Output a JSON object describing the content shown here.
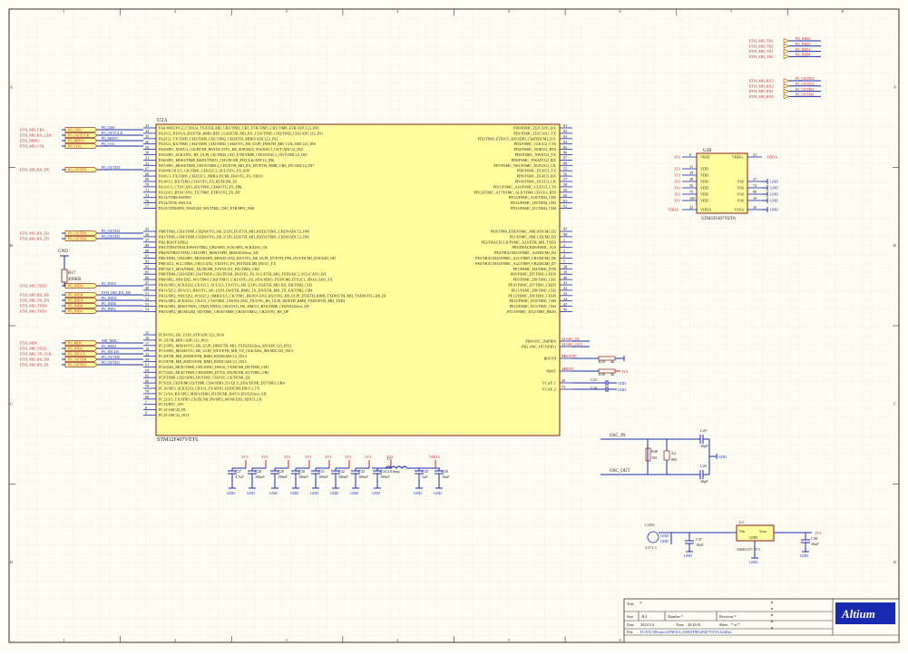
{
  "ruler": {
    "cols": [
      "1",
      "2",
      "3",
      "4",
      "5",
      "6",
      "7",
      "8"
    ],
    "rows": [
      "A",
      "B",
      "C",
      "D"
    ]
  },
  "mcu": {
    "designator": "U2A",
    "part": "STM32F407VET6",
    "left_pins": [
      {
        "num": "23",
        "label": "PA0-WKUP/U2_CTS/U4_TX/ETH_MII_CRS/TIM2_CH1_ETR/TIM5_CH1/TIM8_ETR/ADC123_IN0"
      },
      {
        "num": "24",
        "label": "PA1/U2_RTS/U4_RX/ETH_RMII_REF_CLK/ETH_MII_RX_CLK/TIM5_CH2/TIM2_CH2/ADC123_IN1"
      },
      {
        "num": "25",
        "label": "PA2/U2_TX/TIM5_CH3/TIM9_CH1/TIM2_CH3/ETH_MDIO/ADC123_IN2"
      },
      {
        "num": "26",
        "label": "PA3/U2_RX/TIM5_CH4/TIM9_CH2/TIM2_CH4/OTG_HS_ULPI_D0/ETH_MII_COL/ADC123_IN3"
      },
      {
        "num": "29",
        "label": "PA4/SPI1_NSS/U2_CK/DCMI_HSYNC/OTG_HS_SOF/I2S3_WS/DAC1_OUT/ADC12_IN4"
      },
      {
        "num": "30",
        "label": "PA5/SPI1_SCK/OTG_HS_ULPI_CK/TIM2_CH1_ETR/TIM8_CH1N/DAC2_OUT/ADC12_IN5"
      },
      {
        "num": "31",
        "label": "PA6/SPI1_MISO/TIM8_BKIN/TIM13_CH1/DCMI_PIXCLK/ADC12_IN6"
      },
      {
        "num": "32",
        "label": "PA7/SPI1_MOSI/TIM8_CH1N/TIM14_CH1/ETH_MII_RX_DV/ETH_RMII_CRS_DV/ADC12_IN7"
      },
      {
        "num": "67",
        "label": "PA8/MCO1/U1_CK/TIM1_CH1/I2C3_SCL/OTG_FS_SOF"
      },
      {
        "num": "68",
        "label": "PA9/U1_TX/TIM1_CH2/I2C3_SMBA/DCMI_D0/OTG_FS_VBUS"
      },
      {
        "num": "69",
        "label": "PA10/U1_RX/TIM1_CH3/OTG_FS_ID/DCMI_D1"
      },
      {
        "num": "70",
        "label": "PA11/U1_CTS/CAN1_RX/TIM1_CH4/OTG_FS_DM"
      },
      {
        "num": "71",
        "label": "PA12/U1_RTS/CAN1_TX/TIM1_ETR/OTG_FS_DP"
      },
      {
        "num": "72",
        "label": "PA13/JTMS-SWDIO"
      },
      {
        "num": "76",
        "label": "PA14/JTCK-SWCLK"
      },
      {
        "num": "77",
        "label": "PA15/JTDI/SPI3_NSS/I2S3_WS/TIM2_CH1_ETR/SPI1_NSS"
      },
      {
        "num": "35",
        "label": "PB0/TIM3_CH3/TIM8_CH2N/OTG_HS_ULPI_D1/ETH_MII_RXD2/TIM1_CH2N/ADC12_IN8"
      },
      {
        "num": "36",
        "label": "PB1/TIM3_CH4/TIM8_CH3N/OTG_HS_ULPI_D2/ETH_MII_RXD3/TIM1_CH3N/ADC12_IN9"
      },
      {
        "num": "37",
        "label": "PB2-BOOT1(PB2)"
      },
      {
        "num": "89",
        "label": "PB3/JTDO/TRACESWO/TIM2_CH2/SPI1_SCK/SPI3_SCK/I2S3_CK"
      },
      {
        "num": "90",
        "label": "PB4/NJTRST/TIM3_CH1/SPI1_MISO/SPI3_MISO/I2S3ext_SD"
      },
      {
        "num": "91",
        "label": "PB5/TIM3_CH2/SPI1_MOSI/SPI3_MOSI/CAN2_RX/OTG_HS_ULPI_D7/ETH_PPS_OUT/DCMI_D10/I2S3_SD"
      },
      {
        "num": "92",
        "label": "PB6/I2C1_SCL/TIM4_CH1/CAN2_TX/OTG_FS_INTN/DCMI_D5/U1_TX"
      },
      {
        "num": "93",
        "label": "PB7/I2C1_SDA/FSMC_NL/DCMI_VSYNC/U1_RX/TIM4_CH2"
      },
      {
        "num": "95",
        "label": "PB8/TIM4_CH3/SDIO_D4/TIM10_CH1/DCMI_D6/OTG_FS_SCL/ETH_MII_TXD3/I2C1_SCL/CAN1_RX"
      },
      {
        "num": "96",
        "label": "PB9/SPI2_NSS/I2S2_WS/TIM4_CH4/TIM11_CH1/OTG_FS_SDA/SDIO_D5/DCMI_D7/I2C1_SDA/CAN1_TX"
      },
      {
        "num": "47",
        "label": "PB10/SPI2_SCK/I2S2_CK/I2C2_SCL/U3_TX/OTG_HS_ULPI_D3/ETH_MII_RX_ER/TIM2_CH3"
      },
      {
        "num": "48",
        "label": "PB11/I2C2_SDA/U3_RX/OTG_HS_ULPI_D4/ETH_RMII_TX_EN/ETH_MII_TX_EN/TIM2_CH4"
      },
      {
        "num": "51",
        "label": "PB12/SPI2_NSS/I2S2_WS/I2C2_SMBA/U3_CK/TIM1_BKIN/CAN2_RX/OTG_HS_ULPI_D5/ETH_RMII_TXD0/ETH_MII_TXD0/OTG_HS_ID"
      },
      {
        "num": "52",
        "label": "PB13/SPI2_SCK/I2S2_CK/U3_CTS/TIM1_CH1N/CAN2_TX/OTG_HS_ULPI_D6/ETH_RMII_TXD1/ETH_MII_TXD1"
      },
      {
        "num": "53",
        "label": "PB14/SPI2_MISO/TIM1_CH2N/TIM12_CH1/OTG_HS_DM/U3_RTS/TIM8_CH2N/I2S2ext_SD"
      },
      {
        "num": "54",
        "label": "PB15/SPI2_MOSI/I2S2_SD/TIM1_CH3N/TIM8_CH3N/TIM12_CH2/OTG_HS_DP"
      },
      {
        "num": "15",
        "label": "PC0/OTG_HS_ULPI_STP/ADC123_IN10"
      },
      {
        "num": "16",
        "label": "PC1/ETH_MDC/ADC123_IN11"
      },
      {
        "num": "17",
        "label": "PC2/SPI2_MISO/OTG_HS_ULPI_DIR/ETH_MII_TXD2/I2S2ext_SD/ADC123_IN12"
      },
      {
        "num": "18",
        "label": "PC3/SPI2_MOSI/OTG_HS_ULPI_NXT/ETH_MII_TX_CLK/I2S2_SD/ADC123_IN13"
      },
      {
        "num": "33",
        "label": "PC4/ETH_MII_RXD0/ETH_RMII_RXD0/ADC12_IN14"
      },
      {
        "num": "34",
        "label": "PC5/ETH_MII_RXD1/ETH_RMII_RXD1/ADC12_IN15"
      },
      {
        "num": "63",
        "label": "PC6/I2S2_MCK/TIM8_CH1/SDIO_D6/U6_TX/DCMI_D0/TIM3_CH1"
      },
      {
        "num": "64",
        "label": "PC7/I2S3_MCK/TIM8_CH2/SDIO_D7/U6_RX/DCMI_D1/TIM3_CH2"
      },
      {
        "num": "65",
        "label": "PC8/TIM8_CH3/SDIO_D0/TIM3_CH3/U6_CK/DCMI_D2"
      },
      {
        "num": "66",
        "label": "PC9/I2S_CKIN/MCO2/TIM8_CH4/SDIO_D1/I2C3_SDA/DCMI_D3/TIM3_CH4"
      },
      {
        "num": "78",
        "label": "PC10/SPI3_SCK/I2S3_CK/U4_TX/SDIO_D2/DCMI_D8/U3_TX"
      },
      {
        "num": "79",
        "label": "PC11/U4_RX/SPI3_MISO/SDIO_D3/DCMI_D4/U3_RX/I2S3ext_SD"
      },
      {
        "num": "80",
        "label": "PC12/U5_TX/SDIO_CK/DCMI_D9/SPI3_MOSI/I2S3_SD/U3_CK"
      },
      {
        "num": "7",
        "label": "PC13/RTC_AF1"
      },
      {
        "num": "8",
        "label": "PC14-OSC32_IN"
      },
      {
        "num": "9",
        "label": "PC15-OSC32_OUT"
      }
    ],
    "right_pins": [
      {
        "num": "81",
        "label": "PD0/FSMC_D2/CAN1_RX"
      },
      {
        "num": "82",
        "label": "PD1/FSMC_D3/CAN1_TX"
      },
      {
        "num": "83",
        "label": "PD2/TIM3_ETR/U5_RX/SDIO_CMD/DCMI_D11"
      },
      {
        "num": "84",
        "label": "PD3/FSMC_CLK/U2_CTS"
      },
      {
        "num": "85",
        "label": "PD4/FSMC_NOE/U2_RTS"
      },
      {
        "num": "86",
        "label": "PD5/FSMC_NWE/U2_TX"
      },
      {
        "num": "87",
        "label": "PD6/FSMC_NWAIT/U2_RX"
      },
      {
        "num": "88",
        "label": "PD7/FSMC_NE1/FSMC_NCE2/U2_CK"
      },
      {
        "num": "55",
        "label": "PD8/FSMC_D13/U3_TX"
      },
      {
        "num": "56",
        "label": "PD9/FSMC_D14/U3_RX"
      },
      {
        "num": "57",
        "label": "PD10/FSMC_D15/U3_CK"
      },
      {
        "num": "58",
        "label": "PD11/FSMC_A16/FSMC_CLE/U3_CTS"
      },
      {
        "num": "59",
        "label": "PD12/FSMC_A17/FSMC_ALE/TIM4_CH1/U3_RTS"
      },
      {
        "num": "60",
        "label": "PD13/FSMC_A18/TIM4_CH2"
      },
      {
        "num": "61",
        "label": "PD14/FSMC_D0/TIM4_CH3"
      },
      {
        "num": "62",
        "label": "PD15/FSMC_D1/TIM4_CH4"
      },
      {
        "num": "97",
        "label": "PE0/TIM4_ETR/FSMC_NBL0/DCMI_D2"
      },
      {
        "num": "98",
        "label": "PE1/FSMC_NBL1/DCMI_D3"
      },
      {
        "num": "1",
        "label": "PE2/TRACECLK/FSMC_A23/ETH_MII_TXD3"
      },
      {
        "num": "2",
        "label": "PE3/TRACED0/FSMC_A19"
      },
      {
        "num": "3",
        "label": "PE4/TRACED1/FSMC_A20/DCMI_D4"
      },
      {
        "num": "4",
        "label": "PE5/TRACED2/FSMC_A21/TIM9_CH1/DCMI_D6"
      },
      {
        "num": "5",
        "label": "PE6/TRACED3/FSMC_A22/TIM9_CH2/DCMI_D7"
      },
      {
        "num": "38",
        "label": "PE7/FSMC_D4/TIM1_ETR"
      },
      {
        "num": "39",
        "label": "PE8/FSMC_D5/TIM1_CH1N"
      },
      {
        "num": "40",
        "label": "PE9/FSMC_D6/TIM1_CH1"
      },
      {
        "num": "41",
        "label": "PE10/FSMC_D7/TIM1_CH2N"
      },
      {
        "num": "42",
        "label": "PE11/FSMC_D8/TIM1_CH2"
      },
      {
        "num": "43",
        "label": "PE12/FSMC_D9/TIM1_CH3N"
      },
      {
        "num": "44",
        "label": "PE13/FSMC_D10/TIM1_CH3"
      },
      {
        "num": "45",
        "label": "PE14/FSMC_D11/TIM1_CH4"
      },
      {
        "num": "46",
        "label": "PE15/FSMC_D12/TIM1_BKIN"
      }
    ],
    "osc_pins": [
      {
        "num": "12",
        "label": "PH0-OSC_IN(PH0)",
        "net": "OSC_IN"
      },
      {
        "num": "13",
        "label": "PH1-OSC_OUT(PH1)",
        "net": "OSC_OUT"
      }
    ],
    "ctrl_pins": [
      {
        "num": "94",
        "label": "BOOT0",
        "net": "BOOT0"
      },
      {
        "num": "14",
        "label": "NRST",
        "net": "NRST"
      }
    ],
    "vcap_pins": [
      {
        "num": "49",
        "label": "VCAP_1"
      },
      {
        "num": "73",
        "label": "VCAP_2"
      }
    ]
  },
  "left_ports": [
    {
      "net": "ETH_MII_CRS",
      "port": "P0_CRS",
      "wire": "P0_CRS"
    },
    {
      "net": "ETH_MII_RX_CLK",
      "port": "P0_OUTCLK",
      "wire": "P0_OUTCLK"
    },
    {
      "net": "ETH_MDIO",
      "port": "P0_MDIO",
      "wire": "P0_MDIO"
    },
    {
      "net": "ETH_MII_COL",
      "port": "P0_COL",
      "wire": "P0_COL"
    },
    {
      "net": "ETH_MII_RX_DV",
      "port": "P0_OUTDV",
      "wire": "P0_OUTDV"
    },
    {
      "net": "ETH_MII_RX_D2",
      "port": "P0_OUTD2",
      "wire": "P0_OUTD2"
    },
    {
      "net": "ETH_MII_RX_D3",
      "port": "P0_OUTD3",
      "wire": "P0_OUTD3"
    },
    {
      "net": "ETH_MII_TXD3",
      "port": "P0_IND3",
      "wire": "P0_IND3"
    },
    {
      "net": "ETH_MII_RX_ER",
      "port": "P0_INER",
      "wire": "ETH_MII_RX_ER"
    },
    {
      "net": "ETH_MII_TX_EN",
      "port": "P0_INEN",
      "wire": "P0_INEN"
    },
    {
      "net": "ETH_MII_TXD0",
      "port": "P0_IND0",
      "wire": "P0_IND0"
    },
    {
      "net": "ETH_MII_TXD1",
      "port": "P0_IND1",
      "wire": "P0_IND1"
    },
    {
      "net": "ETH_MDC",
      "port": "P0_MDC",
      "wire": "MII_MDC"
    },
    {
      "net": "ETH_MII_TXD2",
      "port": "P0_IND2",
      "wire": "P0_IND2"
    },
    {
      "net": "ETH_MII_TX_CLK",
      "port": "P0_INCLK",
      "wire": "P0_INCLK"
    },
    {
      "net": "ETH_MII_RX_D0",
      "port": "P0_OUTD0",
      "wire": "P0_OUTD0"
    },
    {
      "net": "ETH_MII_RX_D1",
      "port": "P0_OUTD1",
      "wire": "P0_OUTD1"
    }
  ],
  "right_ports_a": [
    {
      "net": "ETH_MII_TX3",
      "port": "P0_IND3"
    },
    {
      "net": "ETH_MII_TX2",
      "port": "P0_IND2"
    },
    {
      "net": "ETH_MII_TX1",
      "port": "P0_IND1"
    },
    {
      "net": "ETH_MII_TX0",
      "port": "P0_IND0"
    }
  ],
  "right_ports_b": [
    {
      "net": "ETH_MII_RX3",
      "port": "P0_OUTD3"
    },
    {
      "net": "ETH_MII_RX2",
      "port": "P0_OUTD2"
    },
    {
      "net": "ETH_MII_RX1",
      "port": "P0_OUTD1"
    },
    {
      "net": "ETH_MII_RX0",
      "port": "P0_OUTD0"
    }
  ],
  "power": {
    "designator": "U2B",
    "part": "STM32F407VET6",
    "left_pins": [
      {
        "rail": "3V3",
        "num": "6",
        "label": "VBAT"
      },
      {
        "rail": "3V3",
        "num": "11",
        "label": "VDD"
      },
      {
        "rail": "3V3",
        "num": "19",
        "label": "VDD"
      },
      {
        "rail": "3V3",
        "num": "28",
        "label": "VDD"
      },
      {
        "rail": "3V3",
        "num": "50",
        "label": "VDD"
      },
      {
        "rail": "3V3",
        "num": "75",
        "label": "VDD"
      },
      {
        "rail": "3V3",
        "num": "100",
        "label": "VDD"
      },
      {
        "rail": "VDDA",
        "num": "22",
        "label": "VDDA"
      }
    ],
    "right_pins": [
      {
        "rail": "VDDA",
        "num": "21",
        "label": "VREF+"
      },
      {
        "rail": "GND",
        "num": "27",
        "label": "VSS"
      },
      {
        "rail": "GND",
        "num": "74",
        "label": "VSS"
      },
      {
        "rail": "GND",
        "num": "99",
        "label": "VSS"
      },
      {
        "rail": "GND",
        "num": "10",
        "label": "VSS"
      },
      {
        "rail": "GND",
        "num": "20",
        "label": "VSSA"
      }
    ]
  },
  "gnd_top": {
    "label": "GND"
  },
  "r17": {
    "ref": "R17",
    "value": "499KR"
  },
  "boot": {
    "r39": "R39",
    "r39v": "4k",
    "r38": "R38",
    "r38v": "4k",
    "c23": "C23",
    "c24": "C24",
    "rail": "3V3",
    "gnd": "GND"
  },
  "decoupling": {
    "caps": [
      {
        "ref": "C27",
        "value": "4.7uF",
        "rail": "3V3"
      },
      {
        "ref": "C28",
        "value": "100nF",
        "rail": "3V3"
      },
      {
        "ref": "C29",
        "value": "100nF",
        "rail": "3V3"
      },
      {
        "ref": "C30",
        "value": "100nF",
        "rail": "3V3"
      },
      {
        "ref": "C31",
        "value": "100nF",
        "rail": "3V3"
      },
      {
        "ref": "C32",
        "value": "100nF",
        "rail": "3V3"
      },
      {
        "ref": "C33",
        "value": "100nF",
        "rail": "3V3"
      },
      {
        "ref": "C34",
        "value": "100nF",
        "rail": "3V3"
      }
    ],
    "ferrite": {
      "ref": "L5",
      "value": "2.0Amp"
    },
    "vdda_caps": [
      {
        "ref": "C35",
        "value": "1uF"
      },
      {
        "ref": "C36",
        "value": "10nF"
      }
    ],
    "vdda": "VDDA",
    "gnd": "GND"
  },
  "crystal": {
    "osc_in": "OSC_IN",
    "osc_out": "OSC_OUT",
    "r40": "R40",
    "r40v": "1M",
    "x2": "X2",
    "x2v": "8M",
    "c25": "C25",
    "c25v": "20pF",
    "c26": "C26",
    "c26v": "20pF",
    "gnd": "GND"
  },
  "regulator": {
    "conn": "CON1",
    "conn_val": "3.5*1.3",
    "c37": "C37",
    "c37v": "10uF",
    "ref": "U1",
    "vin": "Vin",
    "vout": "Vout",
    "gnd_pin": "GND",
    "part": "AMS1117-3V3",
    "c38": "C38",
    "c38v": "10uF",
    "rail": "3V3",
    "gnd": "GND"
  },
  "title_block": {
    "title_label": "Title",
    "size_label": "Size",
    "size": "A3",
    "number_label": "Number:*",
    "revision_label": "Revision:*",
    "date_label": "Date",
    "date": "2023/3/4",
    "time_label": "Time",
    "time": "20:26:01",
    "sheet_label": "Sheet",
    "sheet": "* of *",
    "file_label": "File",
    "file": "D:\\XX\\3\\Project\\STM32-LAN8\\STM32F407VET6.SchDoc",
    "logo": "Altium",
    "accent": "#1a2ab0"
  },
  "colors": {
    "net_label": "#c81e1e",
    "wire": "#1a2ab0",
    "part_body": "#ffff9f",
    "part_border": "#8b1a1a",
    "text": "#1a1a1a"
  }
}
